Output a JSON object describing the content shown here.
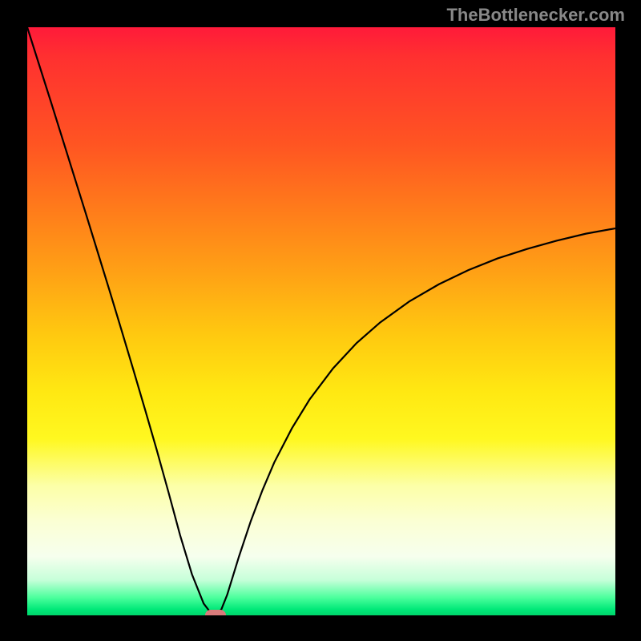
{
  "attribution": "TheBottlenecker.com",
  "chart_data": {
    "type": "line",
    "title": "",
    "xlabel": "",
    "ylabel": "",
    "xlim": [
      0,
      100
    ],
    "ylim": [
      0,
      100
    ],
    "x": [
      0,
      2,
      4,
      6,
      8,
      10,
      12,
      14,
      16,
      18,
      20,
      22,
      24,
      26,
      28,
      30,
      31,
      32,
      33,
      34,
      36,
      38,
      40,
      42,
      45,
      48,
      52,
      56,
      60,
      65,
      70,
      75,
      80,
      85,
      90,
      95,
      100
    ],
    "values": [
      100,
      93.7,
      87.4,
      81.0,
      74.6,
      68.2,
      61.7,
      55.2,
      48.6,
      41.9,
      35.1,
      28.2,
      21.0,
      13.6,
      7.0,
      2.0,
      0.7,
      0.0,
      1.0,
      3.5,
      10.0,
      16.0,
      21.3,
      26.0,
      31.8,
      36.7,
      42.0,
      46.3,
      49.8,
      53.4,
      56.3,
      58.7,
      60.7,
      62.3,
      63.7,
      64.9,
      65.8
    ],
    "marker": {
      "x": 32,
      "y": 0
    },
    "background": "rainbow-gradient-red-to-green",
    "legend": false,
    "grid": false
  },
  "colors": {
    "curve": "#000000",
    "marker": "#d97b7b",
    "frame": "#000000"
  }
}
